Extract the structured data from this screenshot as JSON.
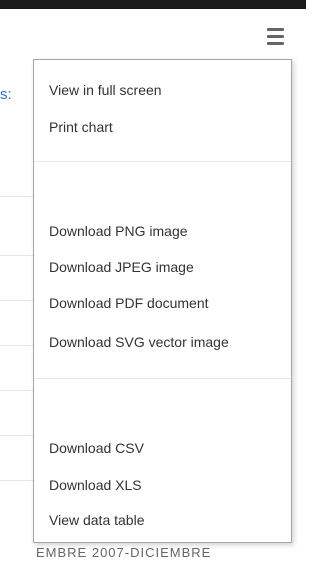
{
  "background": {
    "left_text": "s:",
    "bottom_text": "EMBRE 2007-DICIEMBRE"
  },
  "menu_button": {
    "icon": "hamburger-menu-icon"
  },
  "menu": {
    "items": [
      {
        "label": "View in full screen"
      },
      {
        "label": "Print chart"
      },
      {
        "label": "Download PNG image"
      },
      {
        "label": "Download JPEG image"
      },
      {
        "label": "Download PDF document"
      },
      {
        "label": "Download SVG vector image"
      },
      {
        "label": "Download CSV"
      },
      {
        "label": "Download XLS"
      },
      {
        "label": "View data table"
      }
    ]
  },
  "colors": {
    "top_border": "#1b1b1b",
    "link_blue": "#2b6fc9",
    "menu_text": "#333333",
    "menu_border": "#a6a6a6"
  }
}
